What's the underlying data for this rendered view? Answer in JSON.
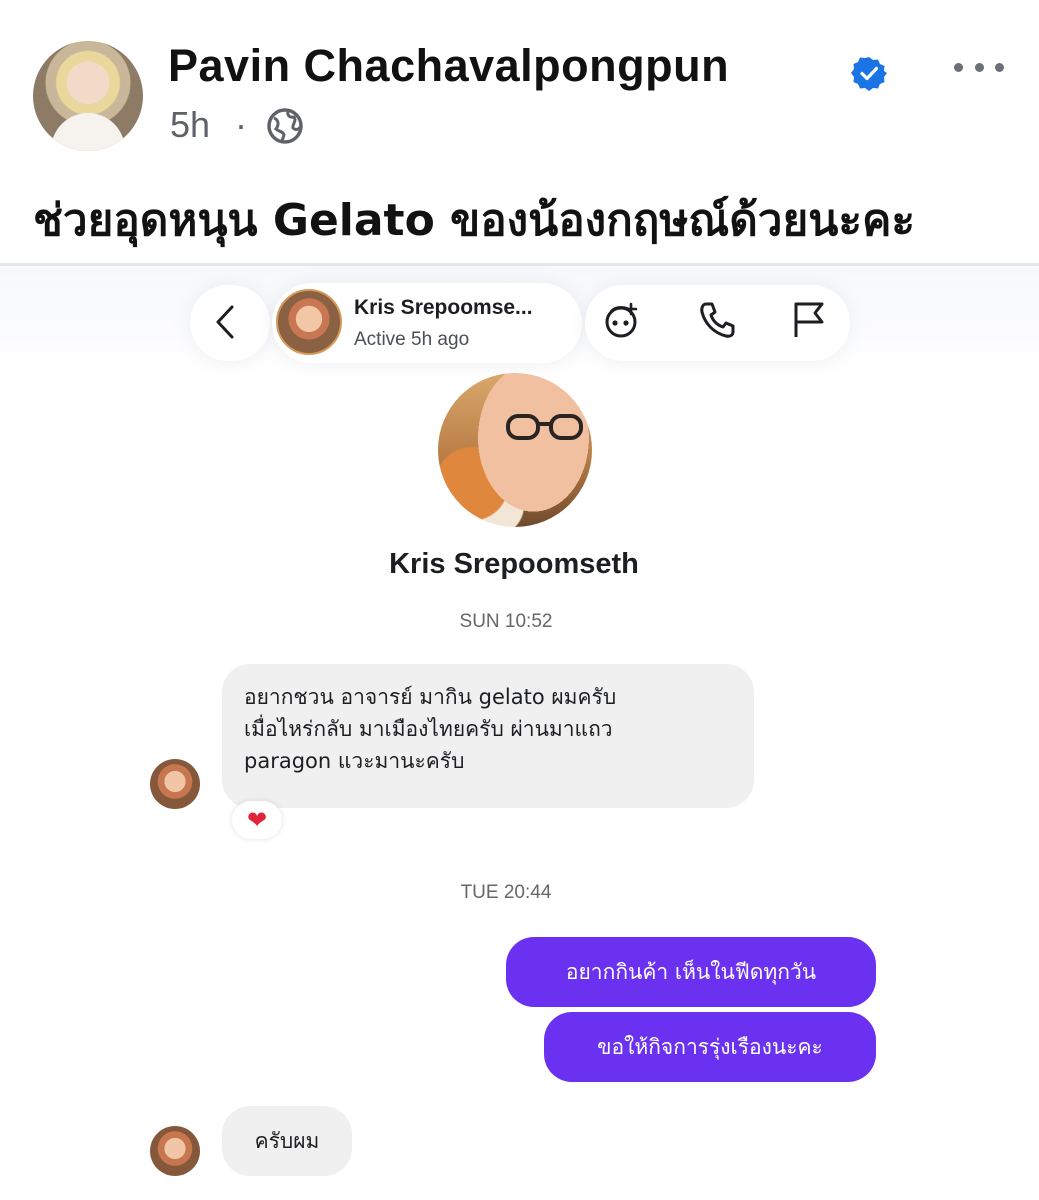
{
  "post": {
    "author": "Pavin Chachavalpongpun",
    "time": "5h",
    "separator": "·",
    "text": "ช่วยอุดหนุน Gelato ของน้องกฤษณ์ด้วยนะคะ"
  },
  "chat": {
    "contact_name_short": "Kris Srepoomse...",
    "status": "Active 5h ago",
    "contact_name": "Kris Srepoomseth",
    "messages": [
      {
        "type": "timestamp",
        "text": "SUN 10:52"
      },
      {
        "type": "incoming",
        "lines": [
          "อยากชวน อาจารย์ มากิน gelato ผมครับ",
          "เมื่อไหร่กลับ มาเมืองไทยครับ ผ่านมาแถว",
          "paragon แวะมานะครับ"
        ],
        "reaction": "❤"
      },
      {
        "type": "timestamp",
        "text": "TUE 20:44"
      },
      {
        "type": "outgoing",
        "text": "อยากกินค้า เห็นในฟีดทุกวัน"
      },
      {
        "type": "outgoing",
        "text": "ขอให้กิจการรุ่งเรืองนะคะ"
      },
      {
        "type": "incoming",
        "text": "ครับผม"
      }
    ]
  },
  "icons": {
    "verified": "verified-badge-icon",
    "more": "more-options-icon",
    "privacy": "globe-icon",
    "back": "chevron-left-icon",
    "effects": "effects-icon",
    "call": "phone-icon",
    "report": "flag-icon"
  },
  "colors": {
    "outgoing_bubble": "#6a31f0",
    "incoming_bubble": "#f0f0f0",
    "verified": "#1b74e4"
  }
}
